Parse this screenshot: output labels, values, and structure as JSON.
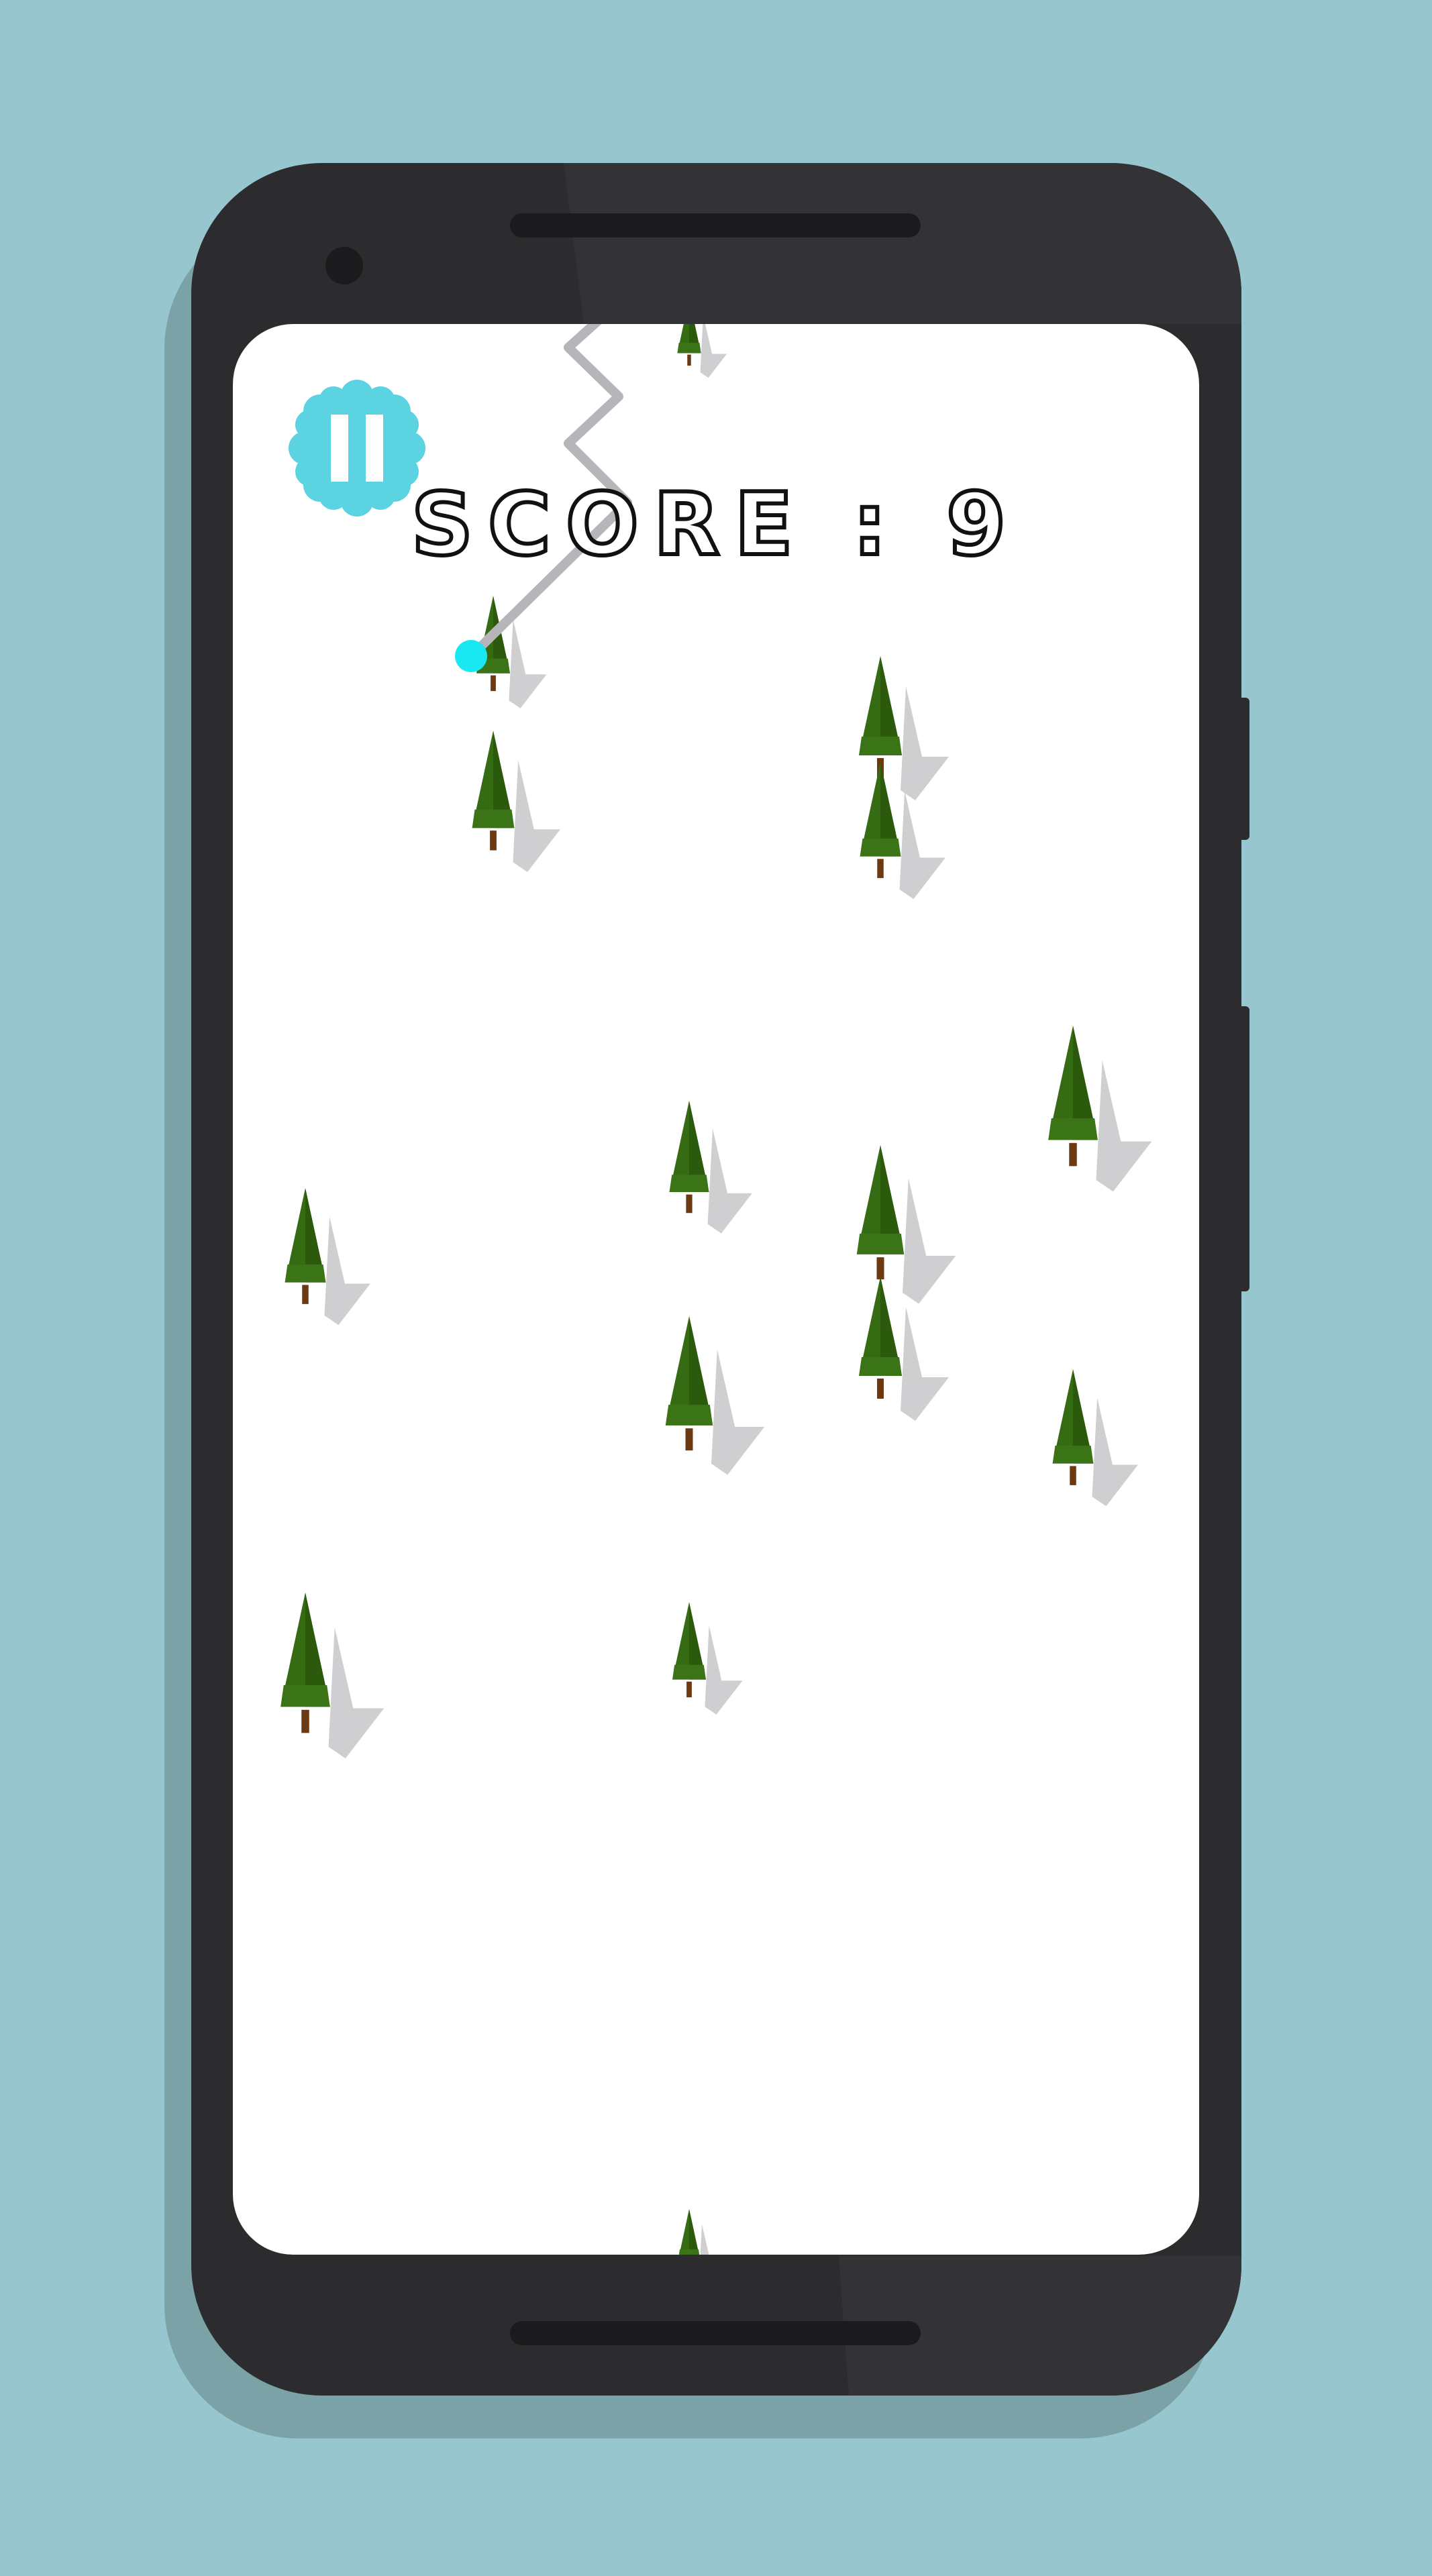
{
  "score": {
    "label": "SCORE",
    "separator": ":",
    "value": "9"
  },
  "colors": {
    "background": "#98c6cf",
    "phone_body": "#2c2b2d",
    "screen": "#ffffff",
    "pause_button": "#5bd3e0",
    "player": "#19e8f2",
    "trail": "#b7b5b9",
    "tree_foliage": "#356b12",
    "tree_trunk": "#6b3a13",
    "tree_shadow": "#cfcfd1"
  },
  "icons": {
    "pause": "pause-icon",
    "player": "player-dot",
    "tree": "pine-tree-icon"
  }
}
